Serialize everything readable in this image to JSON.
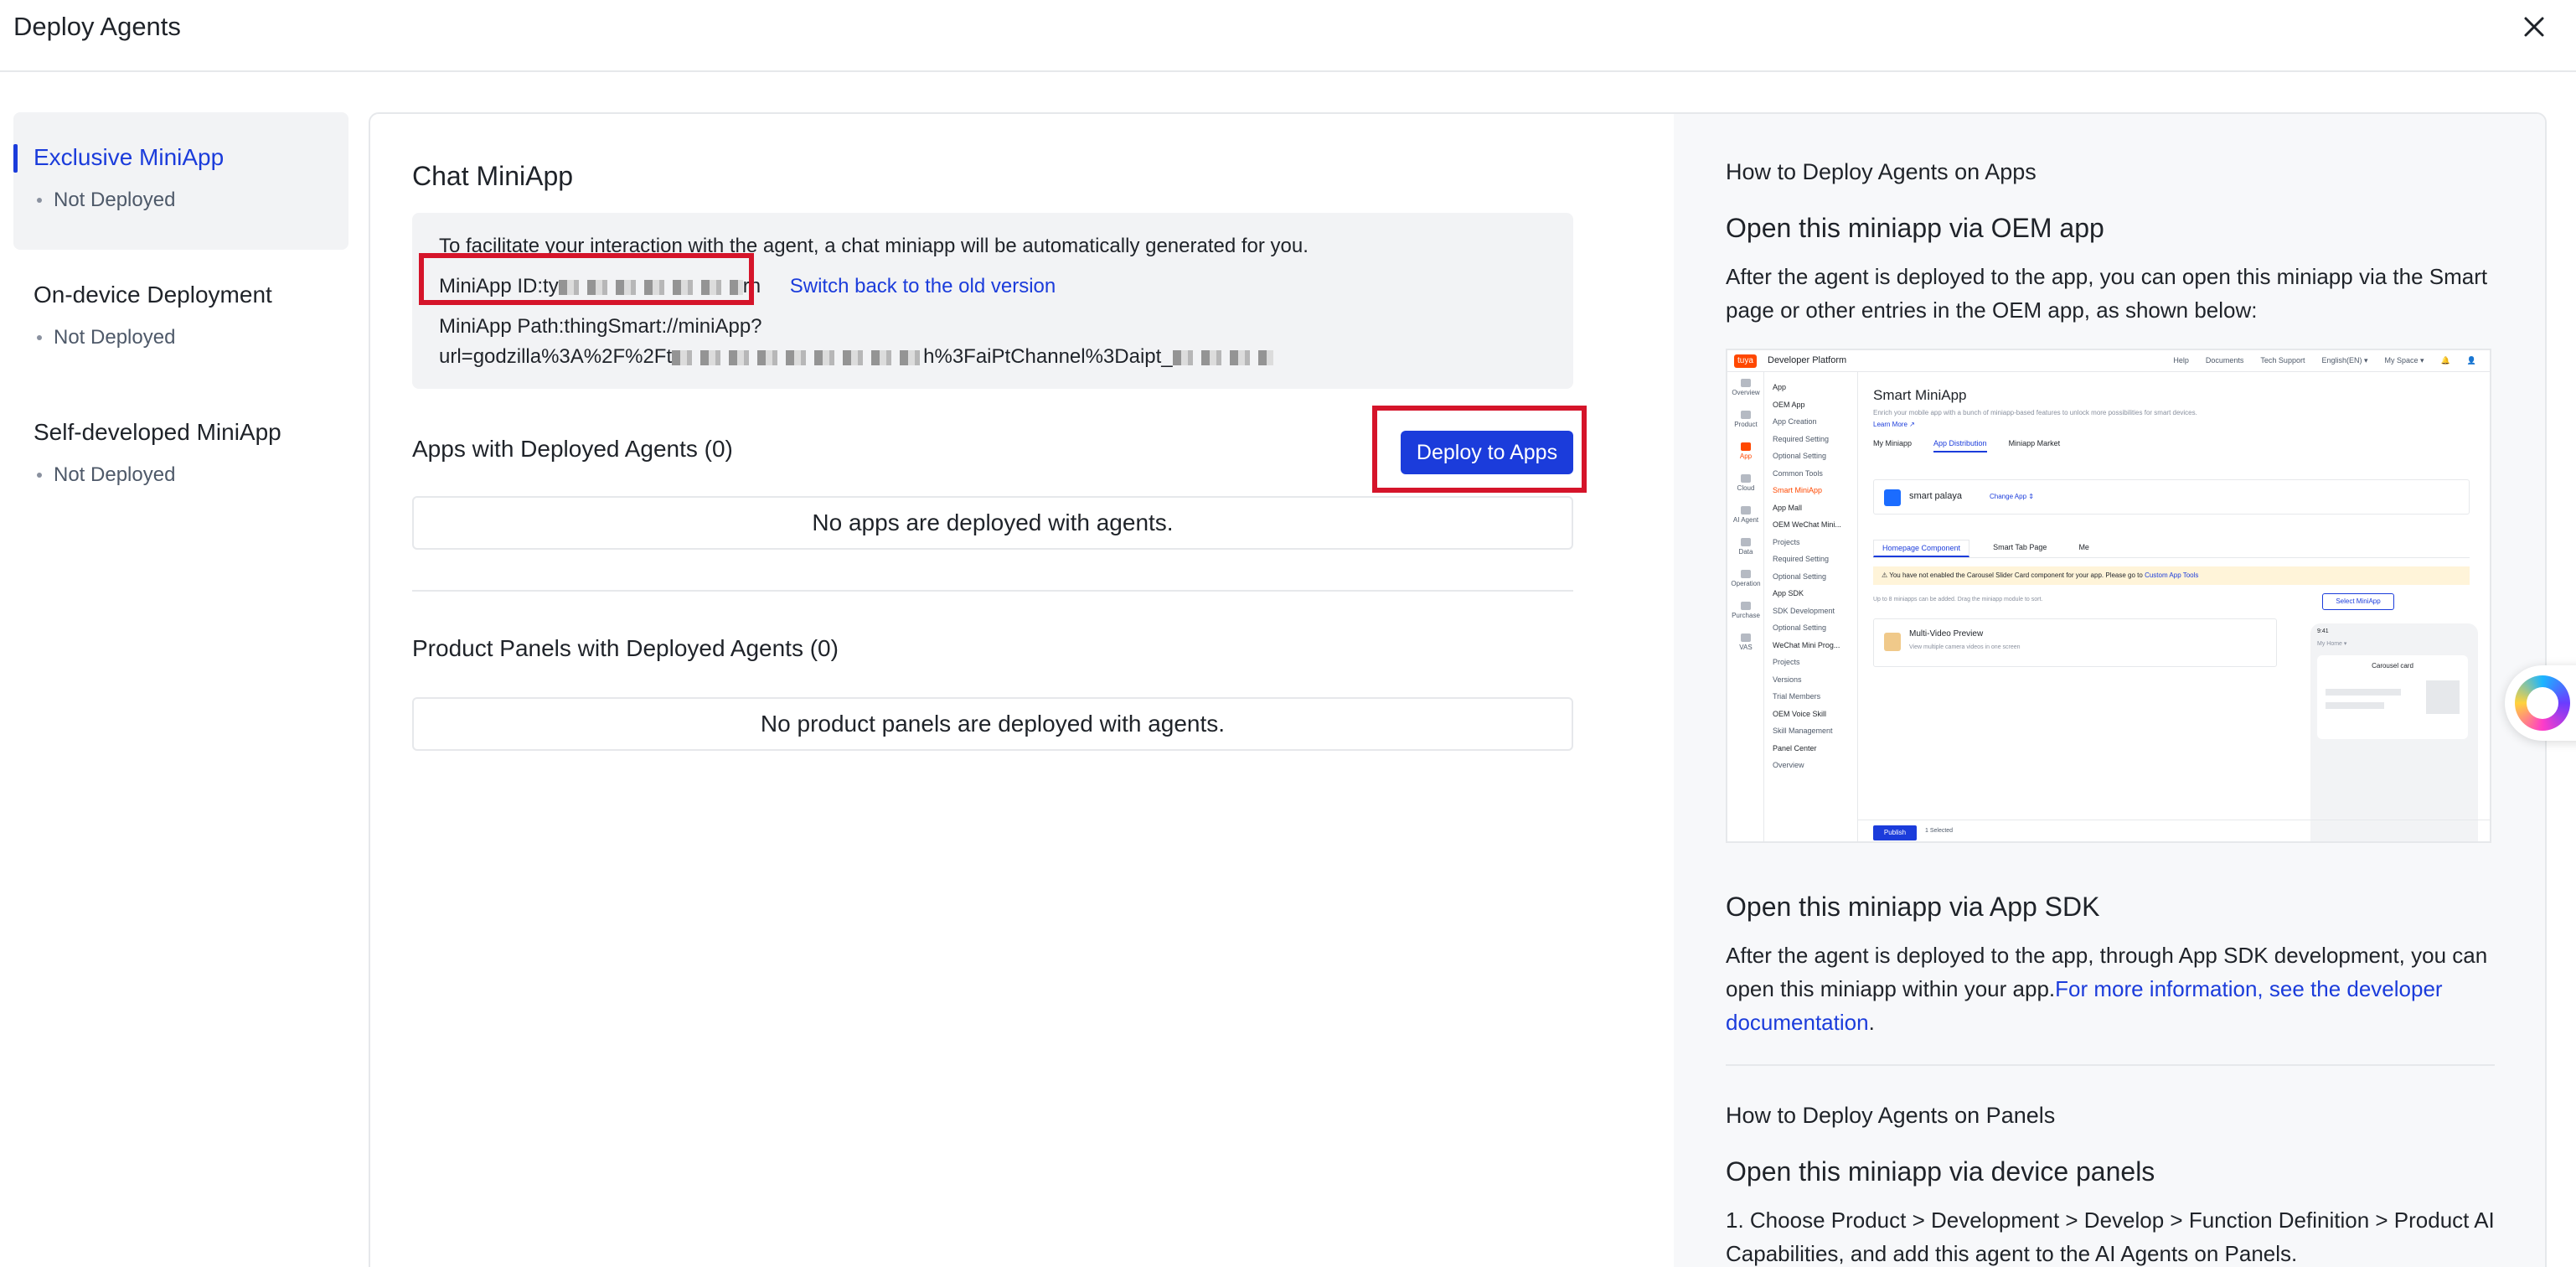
{
  "header": {
    "title": "Deploy Agents"
  },
  "nav": {
    "items": [
      {
        "title": "Exclusive MiniApp",
        "status": "Not Deployed"
      },
      {
        "title": "On-device Deployment",
        "status": "Not Deployed"
      },
      {
        "title": "Self-developed MiniApp",
        "status": "Not Deployed"
      }
    ]
  },
  "main": {
    "title": "Chat MiniApp",
    "info": {
      "intro": "To facilitate your interaction with the agent, a chat miniapp will be automatically generated for you.",
      "id_label": "MiniApp ID:ty",
      "id_suffix": "rh",
      "switch_link": "Switch back to the old version",
      "path_label": "MiniApp Path:thingSmart://miniApp?",
      "path_url_prefix": "url=godzilla%3A%2F%2Ft",
      "path_url_mid": "h%3FaiPtChannel%3Daipt_"
    },
    "apps": {
      "title": "Apps with Deployed Agents (0)",
      "deploy_button": "Deploy to Apps",
      "empty": "No apps are deployed with agents."
    },
    "panels": {
      "title": "Product Panels with Deployed Agents (0)",
      "empty": "No product panels are deployed with agents."
    }
  },
  "guide": {
    "apps_heading": "How to Deploy Agents on Apps",
    "oem_title": "Open this miniapp via OEM app",
    "oem_desc": "After the agent is deployed to the app, you can open this miniapp via the Smart page or other entries in the OEM app, as shown below:",
    "sdk_title": "Open this miniapp via App SDK",
    "sdk_desc": "After the agent is deployed to the app, through App SDK development, you can open this miniapp within your app.",
    "sdk_link": "For more information, see the developer documentation",
    "sdk_link_end": ".",
    "panels_heading": "How to Deploy Agents on Panels",
    "panel_title": "Open this miniapp via device panels",
    "panel_desc": "1. Choose Product > Development > Develop > Function Definition > Product AI Capabilities, and add this agent to the AI Agents on Panels."
  },
  "mini_screenshot": {
    "logo": "tuya",
    "brand": "Developer Platform",
    "top_links": [
      "Help",
      "Documents",
      "Tech Support",
      "English(EN) ▾",
      "My Space ▾"
    ],
    "rail": [
      "Overview",
      "Product",
      "App",
      "Cloud",
      "AI Agent",
      "Data",
      "Operation",
      "Purchase",
      "VAS"
    ],
    "side_items": [
      "App",
      "OEM App",
      "App Creation",
      "Required Setting",
      "Optional Setting",
      "Common Tools",
      "Smart MiniApp",
      "App Mall",
      "OEM WeChat Mini...",
      "Projects",
      "Required Setting",
      "Optional Setting",
      "App SDK",
      "SDK Development",
      "Optional Setting",
      "WeChat Mini Prog...",
      "Projects",
      "Versions",
      "Trial Members",
      "OEM Voice Skill",
      "Skill Management",
      "Panel Center",
      "Overview"
    ],
    "title": "Smart MiniApp",
    "desc": "Enrich your mobile app with a bunch of miniapp-based features to unlock more possibilities for smart devices.",
    "learn_more": "Learn More ↗",
    "tabs": [
      "My Miniapp",
      "App Distribution",
      "Miniapp Market"
    ],
    "app_name": "smart palaya",
    "app_change": "Change App ⇕",
    "sub_tabs": [
      "Homepage Component",
      "Smart Tab Page",
      "Me"
    ],
    "warning": "You have not enabled the Carousel Slider Card component for your app. Please go to",
    "warning_link": "Custom App Tools",
    "count_note": "Up to 8 miniapps can be added. Drag the miniapp module to sort.",
    "select_btn": "Select MiniApp",
    "item_title": "Multi-Video Preview",
    "item_sub": "View multiple camera videos in one screen",
    "phone_time": "9:41",
    "phone_home": "My Home ▾",
    "phone_card": "Carousel card",
    "publish": "Publish",
    "selected": "1 Selected"
  }
}
